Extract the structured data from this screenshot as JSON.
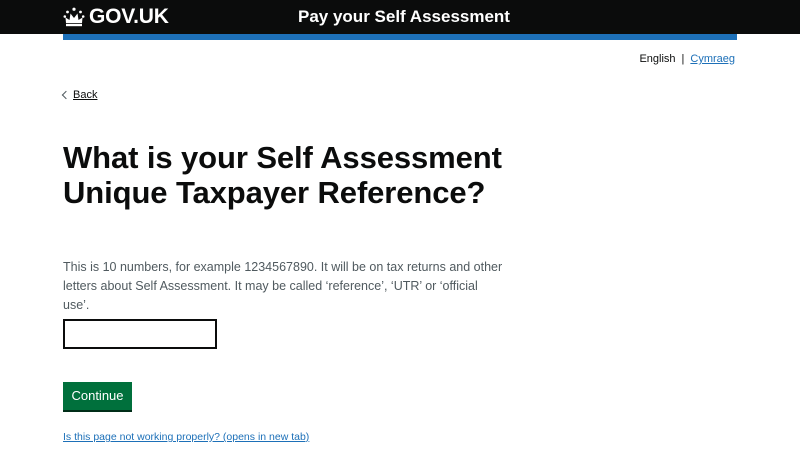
{
  "header": {
    "logo_text": "GOV.UK",
    "logo_icon": "crown-icon",
    "service_name": "Pay your Self Assessment"
  },
  "language": {
    "current": "English",
    "separator": "|",
    "alternate": "Cymraeg"
  },
  "nav": {
    "back_label": "Back"
  },
  "main": {
    "heading": "What is your Self Assessment Unique Taxpayer Reference?",
    "hint": "This is 10 numbers, for example 1234567890. It will be on tax returns and other letters about Self Assessment. It may be called ‘reference’, ‘UTR’ or ‘official use’.",
    "utr_value": "",
    "continue_label": "Continue"
  },
  "footer": {
    "report_link": "Is this page not working properly? (opens in new tab)"
  },
  "colors": {
    "header_bg": "#0b0c0c",
    "accent_bar": "#1d70b8",
    "link": "#1d70b8",
    "button": "#00703c",
    "hint_text": "#505a5f"
  }
}
